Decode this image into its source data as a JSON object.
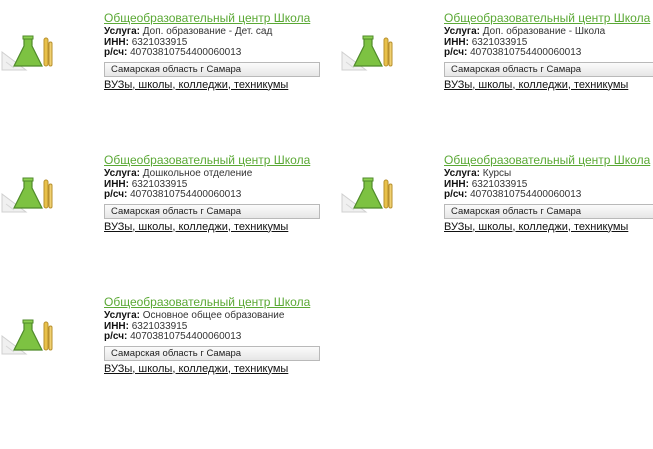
{
  "cards": [
    {
      "title": "Общеобразовательный центр Школа",
      "service_label": "Услуга:",
      "service_value": "Доп. образование - Дет. сад",
      "inn_label": "ИНН:",
      "inn_value": "6321033915",
      "account_label": "р/сч:",
      "account_value": "40703810754400060013",
      "region": "Самарская область г Самара",
      "category": "ВУЗы, школы, колледжи, техникумы"
    },
    {
      "title": "Общеобразовательный центр Школа",
      "service_label": "Услуга:",
      "service_value": "Доп. образование - Школа",
      "inn_label": "ИНН:",
      "inn_value": "6321033915",
      "account_label": "р/сч:",
      "account_value": "40703810754400060013",
      "region": "Самарская область г Самара",
      "category": "ВУЗы, школы, колледжи, техникумы"
    },
    {
      "title": "Общеобразовательный центр Школа",
      "service_label": "Услуга:",
      "service_value": "Дошкольное отделение",
      "inn_label": "ИНН:",
      "inn_value": "6321033915",
      "account_label": "р/сч:",
      "account_value": "40703810754400060013",
      "region": "Самарская область г Самара",
      "category": "ВУЗы, школы, колледжи, техникумы"
    },
    {
      "title": "Общеобразовательный центр Школа",
      "service_label": "Услуга:",
      "service_value": "Курсы",
      "inn_label": "ИНН:",
      "inn_value": "6321033915",
      "account_label": "р/сч:",
      "account_value": "40703810754400060013",
      "region": "Самарская область г Самара",
      "category": "ВУЗы, школы, колледжи, техникумы"
    },
    {
      "title": "Общеобразовательный центр Школа",
      "service_label": "Услуга:",
      "service_value": "Основное общее образование",
      "inn_label": "ИНН:",
      "inn_value": "6321033915",
      "account_label": "р/сч:",
      "account_value": "40703810754400060013",
      "region": "Самарская область г Самара",
      "category": "ВУЗы, школы, колледжи, техникумы"
    }
  ],
  "icon_name": "education-lab-icon",
  "colors": {
    "title_green": "#5aa834",
    "icon_green": "#7dc242",
    "icon_yellow": "#e8c14a"
  }
}
